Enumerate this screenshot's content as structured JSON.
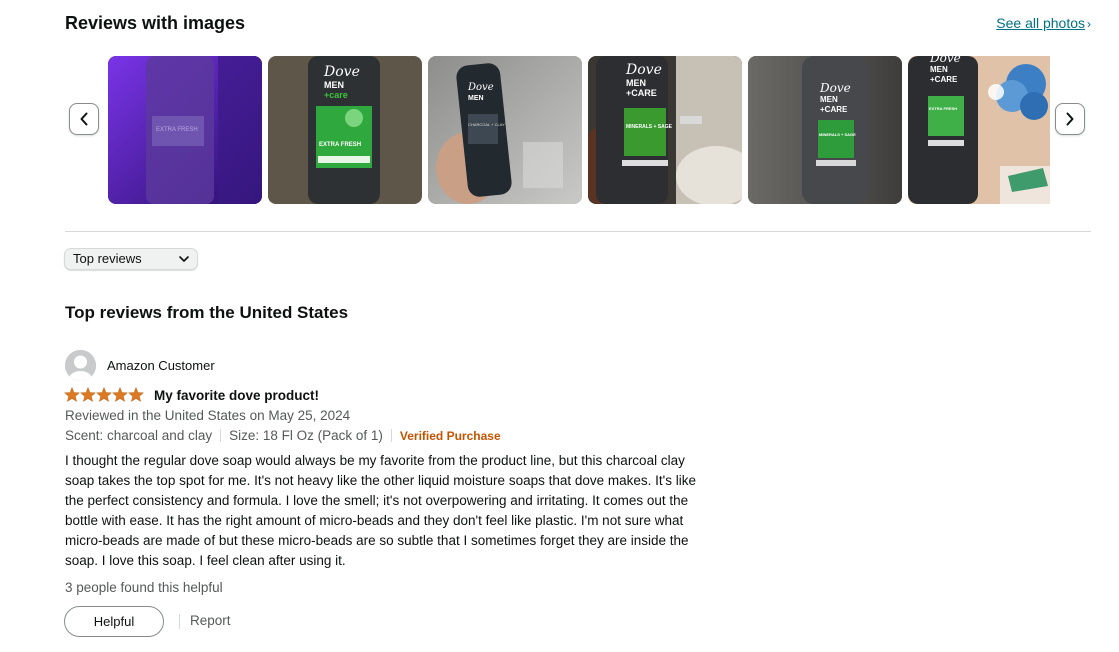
{
  "header": {
    "title": "Reviews with images",
    "see_all": "See all photos",
    "see_all_chevron": "›"
  },
  "carousel": {
    "prev_icon": "chevron-left-icon",
    "next_icon": "chevron-right-icon",
    "images": [
      {
        "label": "EXTRA FRESH",
        "bg": "#4a1fa8"
      },
      {
        "label": "EXTRA FRESH",
        "bg": "#5d5546"
      },
      {
        "label": "CHARCOAL + CLAY",
        "bg": "#9a9a98"
      },
      {
        "label": "MINERALS + SAGE",
        "bg": "#3b3a36"
      },
      {
        "label": "MINERALS + SAGE",
        "bg": "#6e6c69"
      },
      {
        "label": "EXTRA FRESH",
        "bg": "#d6b49a"
      }
    ]
  },
  "sort": {
    "selected": "Top reviews"
  },
  "section": {
    "title": "Top reviews from the United States"
  },
  "review": {
    "author": "Amazon Customer",
    "rating": 5,
    "title": "My favorite dove product!",
    "reviewed_in": "Reviewed in the United States on May 25, 2024",
    "scent": "Scent: charcoal and clay",
    "size": "Size: 18 Fl Oz (Pack of 1)",
    "verified": "Verified Purchase",
    "lines": [
      "I thought the regular dove soap would always be my favorite from the product line, but this charcoal clay",
      "soap takes the top spot for me. It's not heavy like the other liquid moisture soaps that dove makes. It's like",
      "the perfect consistency and formula. I love the smell; it's not overpowering and irritating. It comes out the",
      "bottle with ease. It has the right amount of micro-beads and they don't feel like plastic. I'm not sure what",
      "micro-beads are made of but these micro-beads are so subtle that I sometimes forget they are inside the",
      "soap. I love this soap. I feel clean after using it."
    ],
    "helpful_count": "3 people found this helpful",
    "helpful_button": "Helpful",
    "report": "Report"
  },
  "colors": {
    "link": "#007185",
    "star": "#de7921",
    "verified": "#c45500"
  }
}
